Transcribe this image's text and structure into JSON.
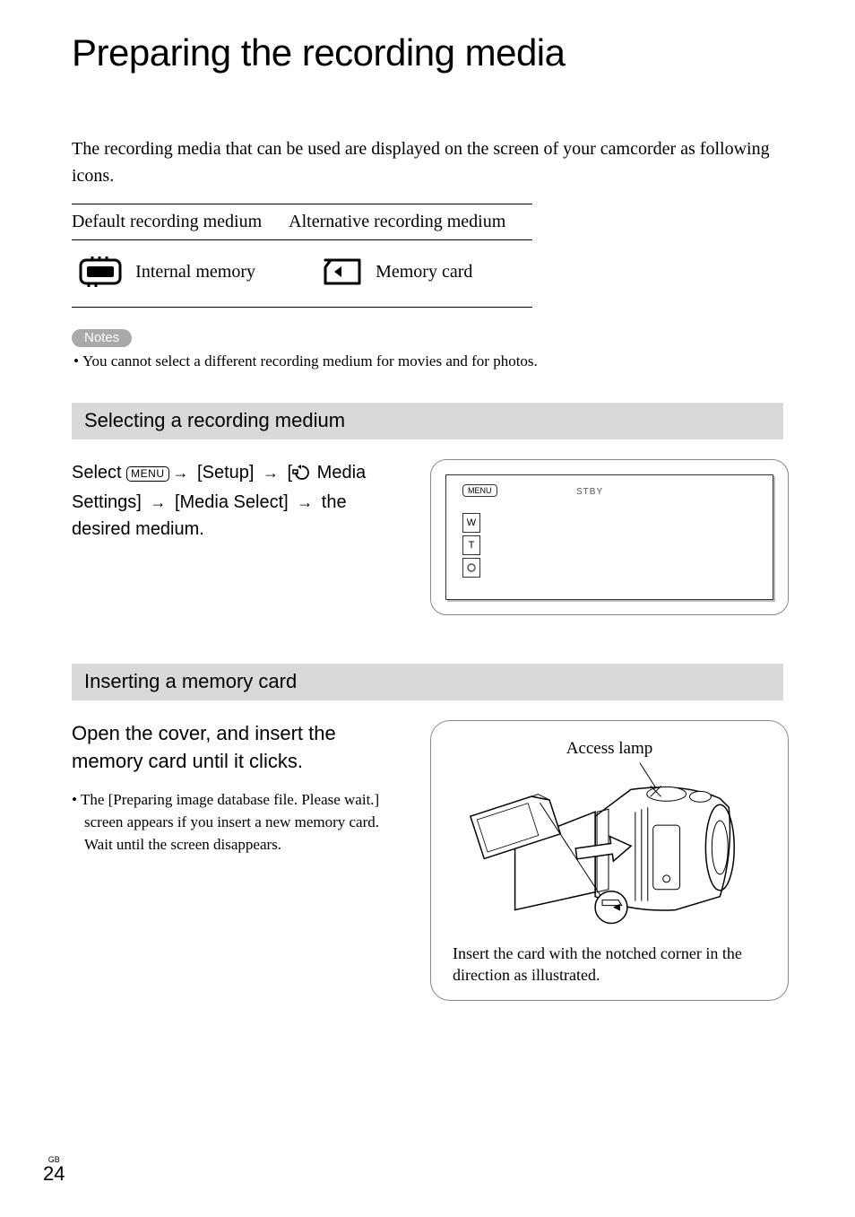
{
  "title": "Preparing the recording media",
  "intro": "The recording media that can be used are displayed on the screen of your camcorder as following icons.",
  "table": {
    "headers": [
      "Default recording medium",
      "Alternative recording medium"
    ],
    "cells": [
      "Internal memory",
      "Memory card"
    ]
  },
  "notes": {
    "label": "Notes",
    "items": [
      "You cannot select a different recording medium for movies and for photos."
    ]
  },
  "section1": {
    "header": "Selecting a recording medium",
    "instr_parts": {
      "select": "Select ",
      "menu_label": "MENU",
      "setup": " [Setup] ",
      "media_settings": " Media Settings] ",
      "media_select": " [Media Select] ",
      "desired": " the desired medium."
    },
    "screen": {
      "menu": "MENU",
      "stby": "STBY",
      "w": "W",
      "t": "T"
    }
  },
  "section2": {
    "header": "Inserting a memory card",
    "instruction": "Open the cover, and insert the memory card until it clicks.",
    "sub_note": "The [Preparing image database file. Please wait.] screen appears if you insert a new memory card. Wait until the screen disappears.",
    "access_lamp": "Access lamp",
    "insert_caption": "Insert the card with the notched corner in the direction as illustrated."
  },
  "footer": {
    "region": "GB",
    "page": "24"
  }
}
